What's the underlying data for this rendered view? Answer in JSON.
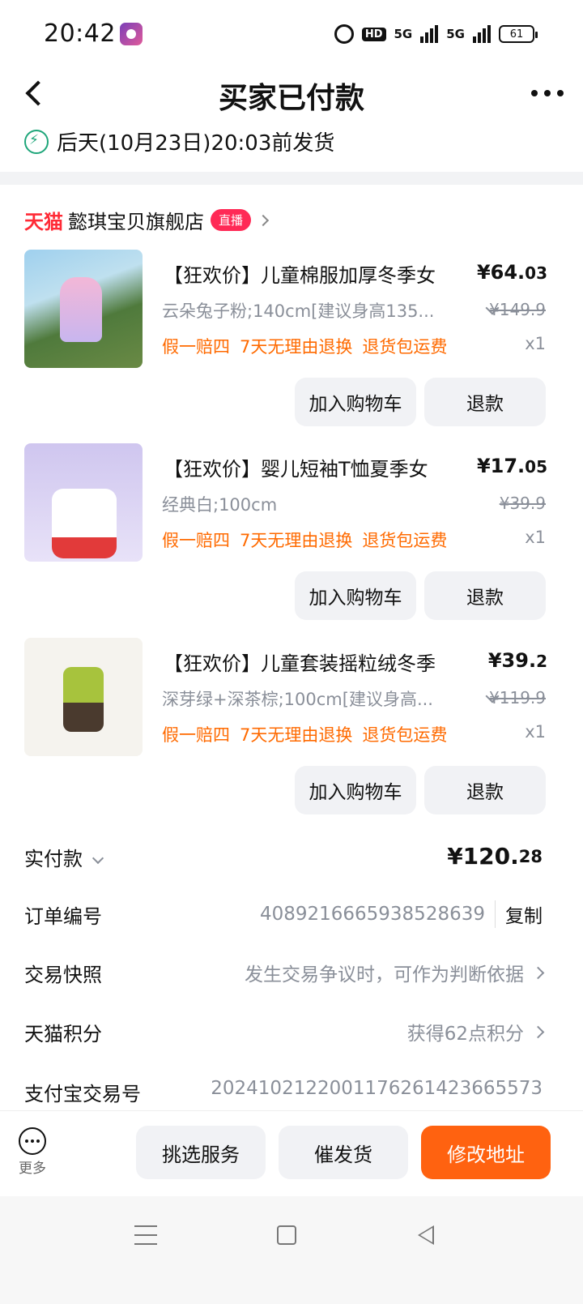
{
  "status_bar": {
    "time": "20:42",
    "hd": "HD",
    "net1": "5G",
    "net2": "5G",
    "battery": "61"
  },
  "header": {
    "title": "买家已付款",
    "shipping_note": "后天(10月23日)20:03前发货"
  },
  "store": {
    "platform": "天猫",
    "name": "懿琪宝贝旗舰店",
    "live_badge": "直播"
  },
  "products": [
    {
      "name": "【狂欢价】儿童棉服加厚冬季女",
      "price_int": "¥64.",
      "price_dec": "03",
      "sku": "云朵兔子粉;140cm[建议身高135...",
      "original_price": "¥149.9",
      "tags": [
        "假一赔四",
        "7天无理由退换",
        "退货包运费"
      ],
      "qty": "x1",
      "cart_label": "加入购物车",
      "refund_label": "退款"
    },
    {
      "name": "【狂欢价】婴儿短袖T恤夏季女",
      "price_int": "¥17.",
      "price_dec": "05",
      "sku": "经典白;100cm",
      "original_price": "¥39.9",
      "tags": [
        "假一赔四",
        "7天无理由退换",
        "退货包运费"
      ],
      "qty": "x1",
      "cart_label": "加入购物车",
      "refund_label": "退款"
    },
    {
      "name": "【狂欢价】儿童套装摇粒绒冬季",
      "price_int": "¥39.",
      "price_dec": "2",
      "sku": "深芽绿+深茶棕;100cm[建议身高...",
      "original_price": "¥119.9",
      "tags": [
        "假一赔四",
        "7天无理由退换",
        "退货包运费"
      ],
      "qty": "x1",
      "cart_label": "加入购物车",
      "refund_label": "退款"
    }
  ],
  "order_info": {
    "paid_label": "实付款",
    "paid_int": "¥120.",
    "paid_dec": "28",
    "order_no_label": "订单编号",
    "order_no": "4089216665938528639",
    "copy_label": "复制",
    "snapshot_label": "交易快照",
    "snapshot_value": "发生交易争议时，可作为判断依据",
    "points_label": "天猫积分",
    "points_value": "获得62点积分",
    "alipay_label": "支付宝交易号",
    "alipay_value": "2024102122001176261423665573"
  },
  "bottom_bar": {
    "more_label": "更多",
    "btn_service": "挑选服务",
    "btn_urge": "催发货",
    "btn_address": "修改地址"
  },
  "colors": {
    "accent": "#ff6210",
    "tag": "#ff6a00",
    "tmall_red": "#ff2a36",
    "ship_green": "#1fa67a"
  }
}
